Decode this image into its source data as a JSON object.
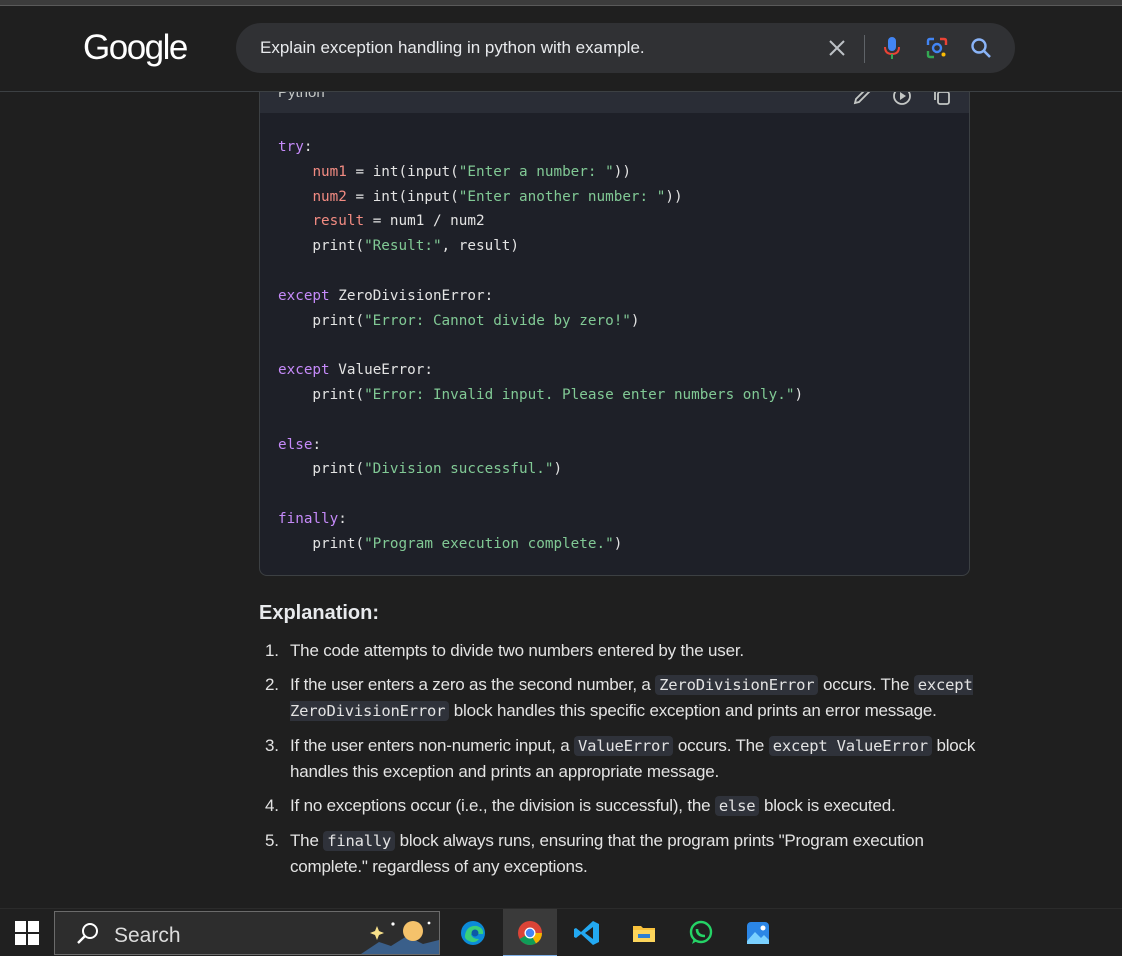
{
  "header": {
    "logo": "Google",
    "search_query": "Explain exception handling in python with example."
  },
  "code_block": {
    "language": "Python"
  },
  "explanation": {
    "title": "Explanation:",
    "items": [
      {
        "num": "1.",
        "text": "The code attempts to divide two numbers entered by the user."
      },
      {
        "num": "2.",
        "parts": [
          "If the user enters a zero as the second number, a ",
          "ZeroDivisionError",
          " occurs. The ",
          "except ZeroDivisionError",
          " block handles this specific exception and prints an error message."
        ]
      },
      {
        "num": "3.",
        "parts": [
          "If the user enters non-numeric input, a ",
          "ValueError",
          " occurs. The ",
          "except ValueError",
          " block handles this exception and prints an appropriate message."
        ]
      },
      {
        "num": "4.",
        "parts": [
          "If no exceptions occur (i.e., the division is successful), the ",
          "else",
          " block is executed."
        ]
      },
      {
        "num": "5.",
        "parts": [
          "The ",
          "finally",
          " block always runs, ensuring that the program prints \"Program execution complete.\" regardless of any exceptions."
        ]
      }
    ]
  },
  "taskbar": {
    "search_placeholder": "Search",
    "apps": [
      "edge-icon",
      "chrome-icon",
      "vscode-icon",
      "file-explorer-icon",
      "whatsapp-icon",
      "photos-icon"
    ]
  },
  "colors": {
    "background": "#1f1f1f",
    "search_box": "#303134",
    "code_bg": "#1e2028",
    "keyword": "#c58af9",
    "string": "#81c995",
    "variable": "#f28b82",
    "mic_blue": "#4285f4"
  }
}
